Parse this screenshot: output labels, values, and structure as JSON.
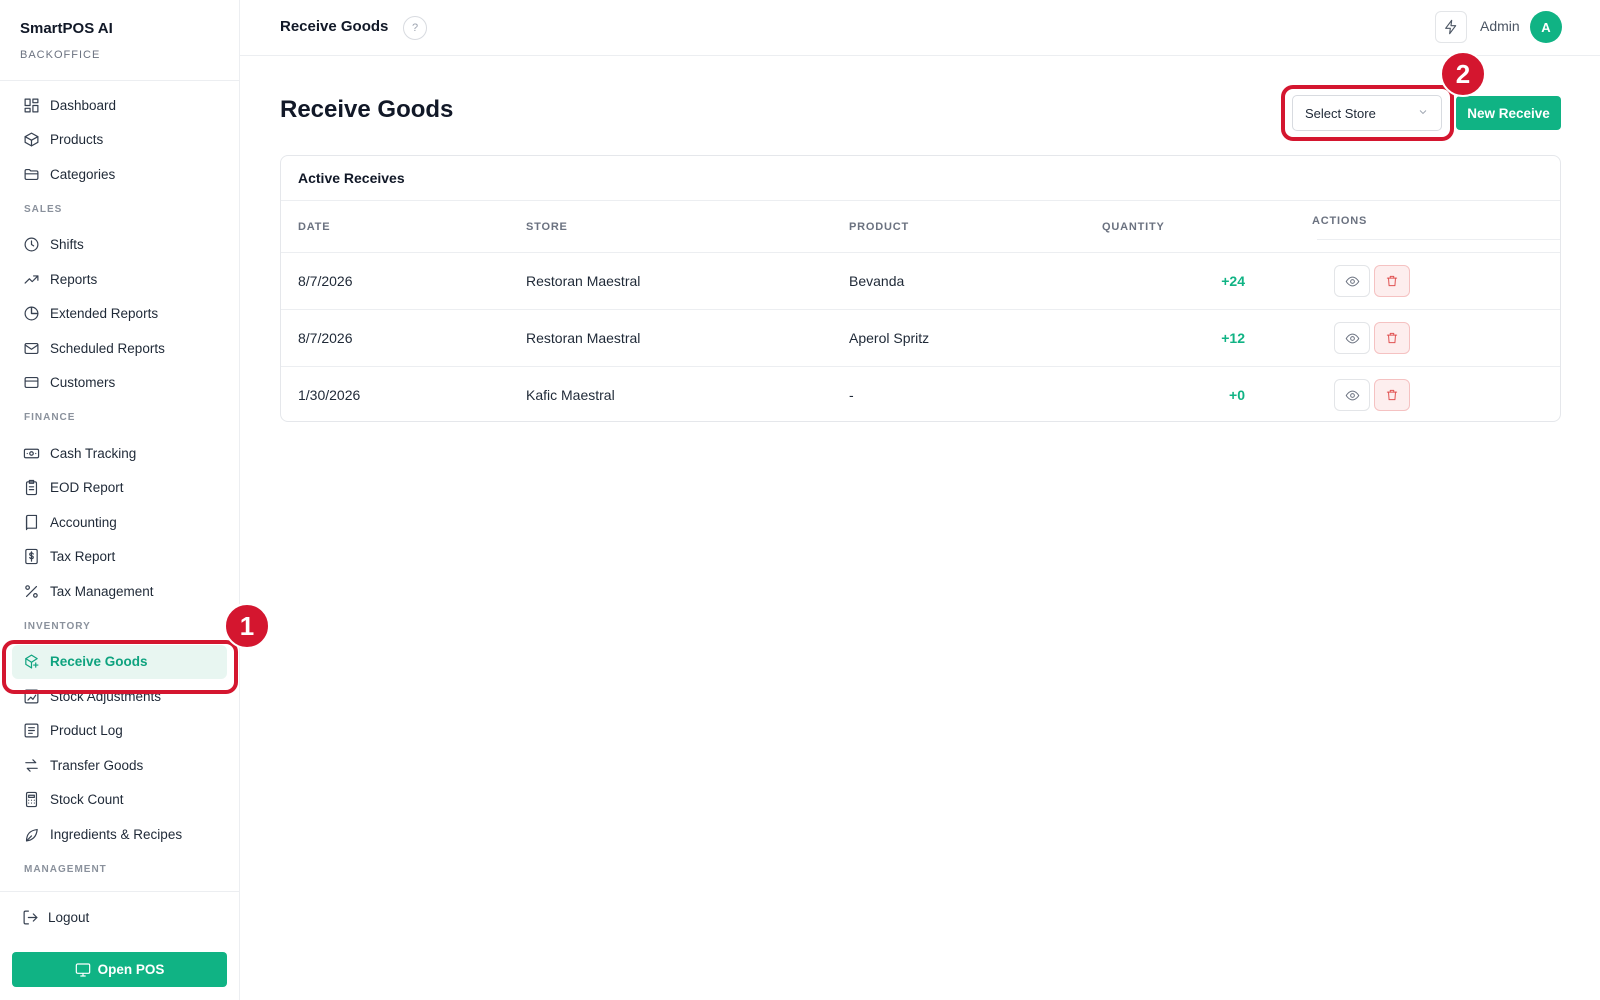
{
  "brand": {
    "name": "SmartPOS AI",
    "subtitle": "BACKOFFICE"
  },
  "sidebar": {
    "sections": [
      {
        "label": "",
        "items": [
          {
            "label": "Dashboard",
            "icon": "dashboard-icon"
          },
          {
            "label": "Products",
            "icon": "box-icon"
          },
          {
            "label": "Categories",
            "icon": "folder-icon"
          }
        ]
      },
      {
        "label": "SALES",
        "items": [
          {
            "label": "Shifts",
            "icon": "clock-icon"
          },
          {
            "label": "Reports",
            "icon": "trending-up-icon"
          },
          {
            "label": "Extended Reports",
            "icon": "pie-chart-icon"
          },
          {
            "label": "Scheduled Reports",
            "icon": "mail-icon"
          },
          {
            "label": "Customers",
            "icon": "card-icon"
          }
        ]
      },
      {
        "label": "FINANCE",
        "items": [
          {
            "label": "Cash Tracking",
            "icon": "cash-icon"
          },
          {
            "label": "EOD Report",
            "icon": "clipboard-icon"
          },
          {
            "label": "Accounting",
            "icon": "book-icon"
          },
          {
            "label": "Tax Report",
            "icon": "dollar-doc-icon"
          },
          {
            "label": "Tax Management",
            "icon": "percent-icon"
          }
        ]
      },
      {
        "label": "INVENTORY",
        "items": [
          {
            "label": "Receive Goods",
            "icon": "package-plus-icon",
            "active": true
          },
          {
            "label": "Stock Adjustments",
            "icon": "adjust-icon"
          },
          {
            "label": "Product Log",
            "icon": "list-icon"
          },
          {
            "label": "Transfer Goods",
            "icon": "arrows-icon"
          },
          {
            "label": "Stock Count",
            "icon": "calculator-icon"
          },
          {
            "label": "Ingredients & Recipes",
            "icon": "leaf-icon"
          }
        ]
      },
      {
        "label": "MANAGEMENT",
        "items": []
      }
    ],
    "logout_label": "Logout",
    "open_pos_label": "Open POS"
  },
  "topbar": {
    "title": "Receive Goods",
    "help_glyph": "?",
    "user_label": "Admin",
    "avatar_initial": "A"
  },
  "main": {
    "title": "Receive Goods",
    "select_store_label": "Select Store",
    "new_receive_label": "New Receive",
    "card_title": "Active Receives",
    "columns": {
      "date": "DATE",
      "store": "STORE",
      "product": "PRODUCT",
      "quantity": "QUANTITY",
      "actions": "ACTIONS"
    },
    "rows": [
      {
        "date": "8/7/2026",
        "store": "Restoran Maestral",
        "product": "Bevanda",
        "quantity": "+24"
      },
      {
        "date": "8/7/2026",
        "store": "Restoran Maestral",
        "product": "Aperol Spritz",
        "quantity": "+12"
      },
      {
        "date": "1/30/2026",
        "store": "Kafic Maestral",
        "product": "-",
        "quantity": "+0"
      }
    ]
  },
  "annotations": [
    {
      "number": "1",
      "color": "#d4162f"
    },
    {
      "number": "2",
      "color": "#d4162f"
    }
  ],
  "colors": {
    "accent": "#10b384",
    "danger": "#e05252",
    "annotation": "#d4162f"
  }
}
